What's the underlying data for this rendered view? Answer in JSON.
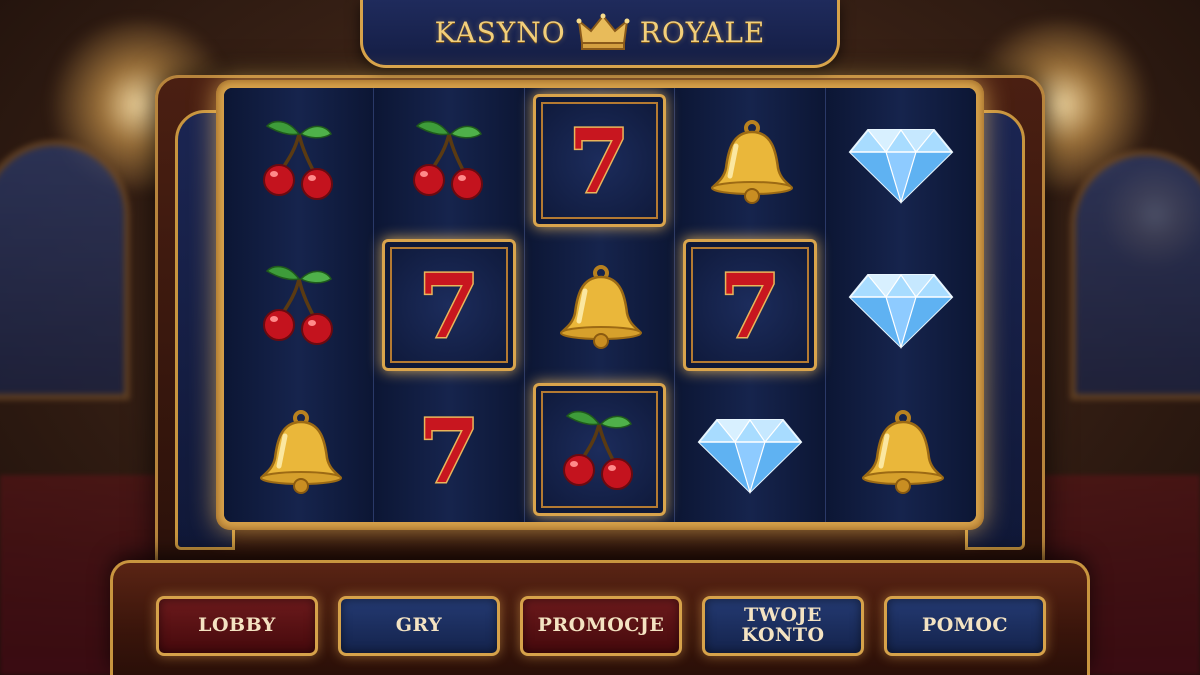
{
  "header": {
    "title_left": "KASYNO",
    "title_right": "ROYALE",
    "crown_icon": "crown-icon"
  },
  "reels": [
    [
      "cherry",
      "cherry",
      "bell"
    ],
    [
      "cherry",
      "seven",
      "seven"
    ],
    [
      "seven",
      "bell",
      "cherry"
    ],
    [
      "bell",
      "seven",
      "diamond"
    ],
    [
      "diamond",
      "diamond",
      "bell"
    ]
  ],
  "highlighted_cells": [
    [
      2,
      0
    ],
    [
      1,
      1
    ],
    [
      3,
      1
    ],
    [
      2,
      2
    ]
  ],
  "menu": {
    "buttons": [
      {
        "label": "LOBBY",
        "style": "red"
      },
      {
        "label": "GRY",
        "style": "blue"
      },
      {
        "label": "PROMOCJE",
        "style": "red"
      },
      {
        "label": "TWOJE\nKONTO",
        "style": "blue"
      },
      {
        "label": "POMOC",
        "style": "blue"
      }
    ]
  },
  "colors": {
    "gold": "#d9a44c",
    "navy": "#141d44",
    "burgundy": "#45090c",
    "text_gold": "#f2cf7a"
  }
}
